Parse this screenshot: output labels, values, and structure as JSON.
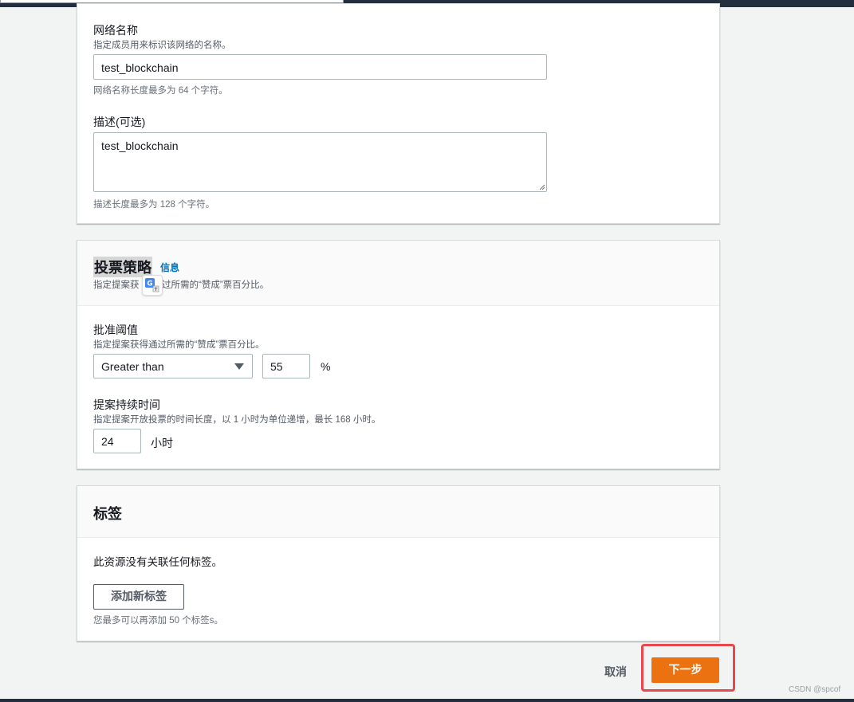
{
  "network": {
    "name_label": "网络名称",
    "name_desc": "指定成员用来标识该网络的名称。",
    "name_value": "test_blockchain",
    "name_hint": "网络名称长度最多为 64 个字符。",
    "desc_label": "描述(可选)",
    "desc_value": "test_blockchain",
    "desc_hint": "描述长度最多为 128 个字符。"
  },
  "voting": {
    "title": "投票策略",
    "info_link": "信息",
    "subtitle_left": "指定提案获",
    "subtitle_right": "过所需的“赞成”票百分比。",
    "threshold_label": "批准阈值",
    "threshold_desc": "指定提案获得通过所需的“赞成”票百分比。",
    "comparator_selected": "Greater than",
    "threshold_value": "55",
    "threshold_unit": "%",
    "duration_label": "提案持续时间",
    "duration_desc": "指定提案开放投票的时间长度，以 1 小时为单位递增，最长 168 小时。",
    "duration_value": "24",
    "duration_unit": "小时"
  },
  "tags": {
    "title": "标签",
    "empty_text": "此资源没有关联任何标签。",
    "add_button": "添加新标签",
    "limit_hint": "您最多可以再添加 50 个标签s。"
  },
  "footer": {
    "cancel": "取消",
    "next": "下一步"
  },
  "watermark": "CSDN @spcof",
  "colors": {
    "primary": "#ec7211",
    "link": "#0073bb",
    "highlight": "#e8474c",
    "topbar": "#232f3e"
  }
}
